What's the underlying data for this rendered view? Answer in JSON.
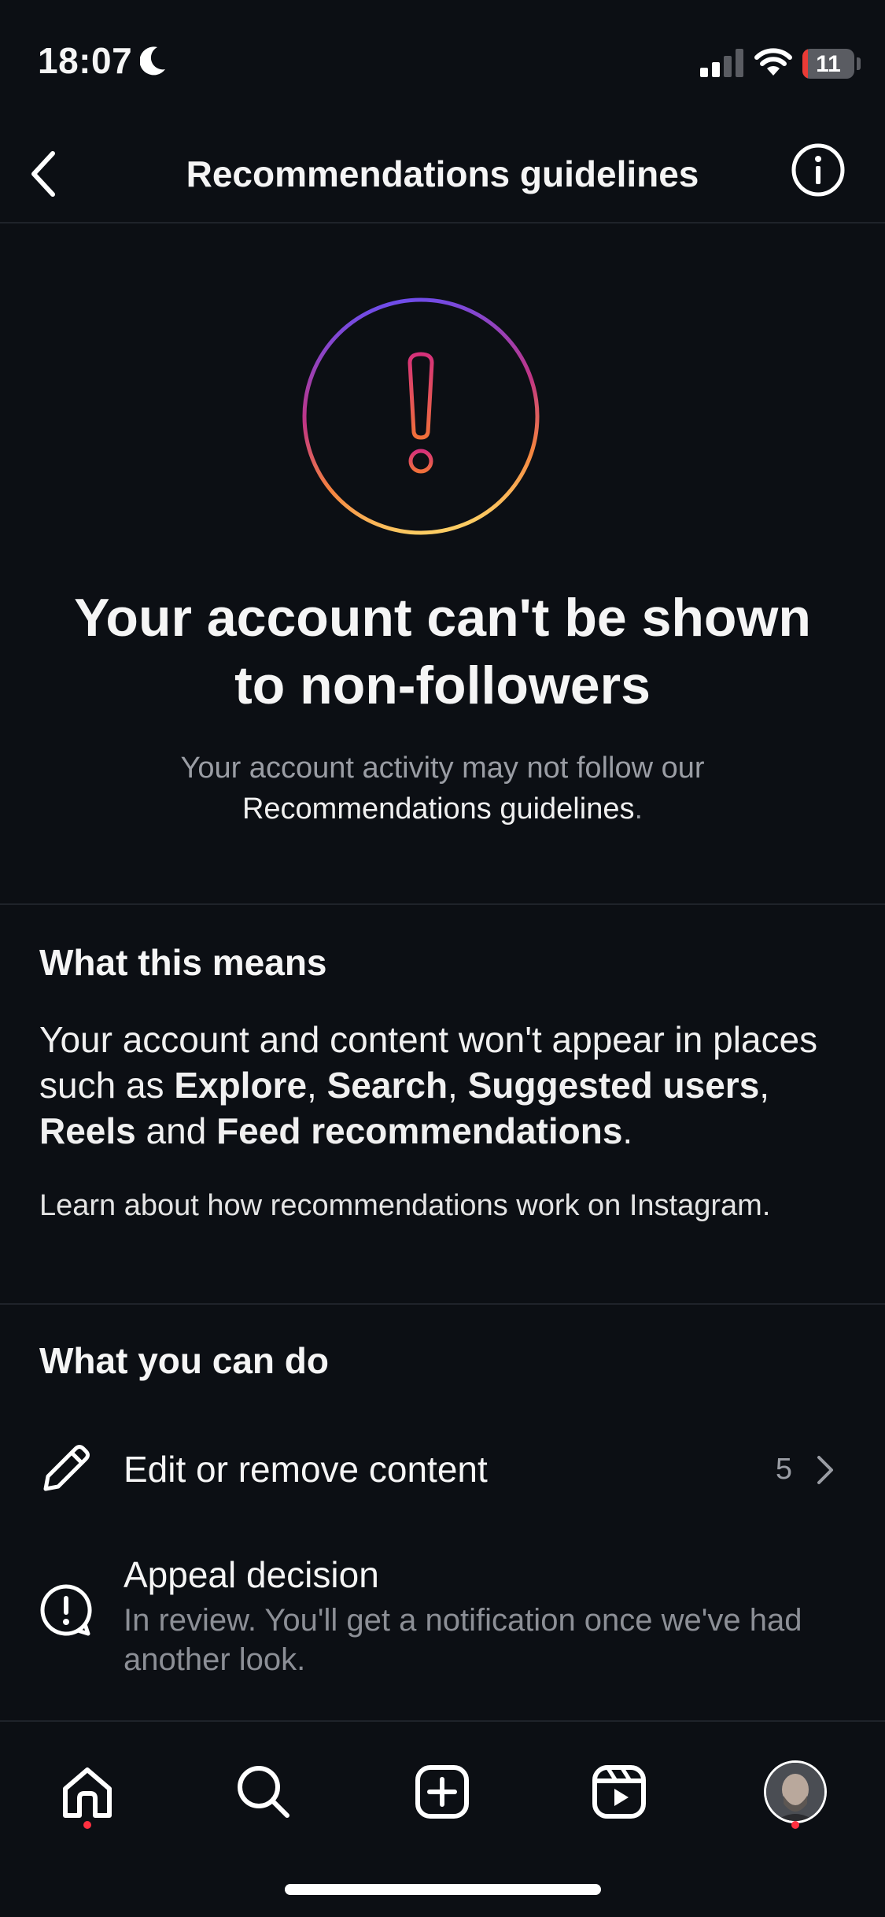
{
  "status_bar": {
    "time": "18:07",
    "battery_level": "11",
    "battery_fraction": 0.11,
    "icons": [
      "moon-icon",
      "signal-icon",
      "wifi-icon",
      "battery-icon"
    ]
  },
  "header": {
    "title": "Recommendations guidelines",
    "back_icon": "chevron-left-icon",
    "info_icon": "info-icon"
  },
  "hero": {
    "icon": "exclamation-icon",
    "title": "Your account can't be shown to non-followers",
    "subtitle_prefix": "Your account activity may not follow our",
    "subtitle_link": "Recommendations guidelines",
    "subtitle_suffix": "."
  },
  "what_this_means": {
    "heading": "What this means",
    "body_parts": [
      {
        "text": "Your account and content won't appear in places such as ",
        "bold": false
      },
      {
        "text": "Explore",
        "bold": true
      },
      {
        "text": ", ",
        "bold": false
      },
      {
        "text": "Search",
        "bold": true
      },
      {
        "text": ", ",
        "bold": false
      },
      {
        "text": "Suggested users",
        "bold": true
      },
      {
        "text": ", ",
        "bold": false
      },
      {
        "text": "Reels",
        "bold": true
      },
      {
        "text": " and ",
        "bold": false
      },
      {
        "text": "Feed recommendations",
        "bold": true
      },
      {
        "text": ".",
        "bold": false
      }
    ],
    "learn_text": "Learn about how recommendations work on Instagram."
  },
  "what_you_can_do": {
    "heading": "What you can do",
    "actions": [
      {
        "label": "Edit or remove content",
        "count": "5",
        "icon": "pencil-icon"
      },
      {
        "label": "Appeal decision",
        "sub": "In review. You'll get a notification once we've had another look.",
        "icon": "appeal-icon"
      }
    ]
  },
  "tab_bar": {
    "tabs": [
      {
        "name": "home",
        "icon": "home-icon",
        "has_dot": true
      },
      {
        "name": "search",
        "icon": "search-icon",
        "has_dot": false
      },
      {
        "name": "create",
        "icon": "plus-square-icon",
        "has_dot": false
      },
      {
        "name": "reels",
        "icon": "reels-icon",
        "has_dot": false
      },
      {
        "name": "profile",
        "icon": "avatar",
        "has_dot": true
      }
    ]
  },
  "colors": {
    "background": "#0c0f14",
    "text_primary": "#f5f5f5",
    "text_secondary": "#9a9da4",
    "notification_dot": "#ff3040",
    "ring_gradient": [
      "#6a4ef0",
      "#c13584",
      "#f5833f",
      "#fccc63"
    ]
  }
}
